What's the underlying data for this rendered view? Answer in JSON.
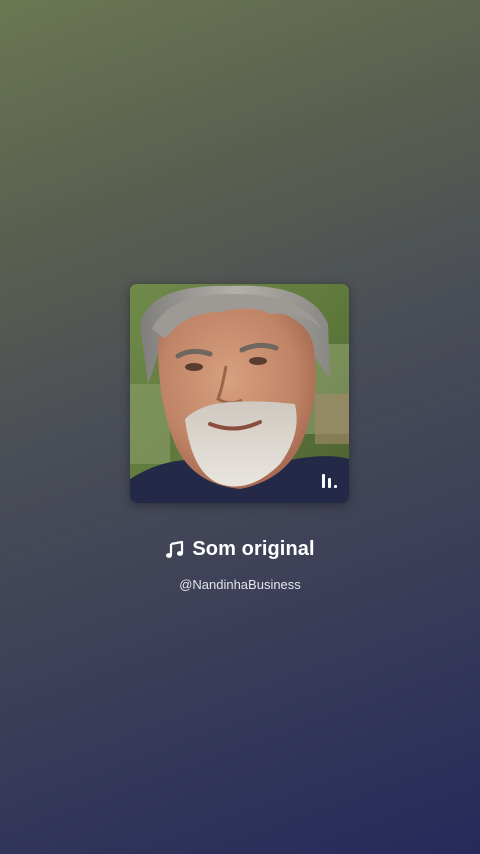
{
  "audio": {
    "title": "Som original",
    "author": "@NandinhaBusiness",
    "cover_image": "portrait of a smiling grey-haired man with a white beard",
    "title_icon": "music-note-icon",
    "cover_overlay_icon": "sound-bars-icon"
  },
  "colors": {
    "background_top": "#6b7752",
    "background_bottom": "#262a5a",
    "text": "#ffffff"
  }
}
